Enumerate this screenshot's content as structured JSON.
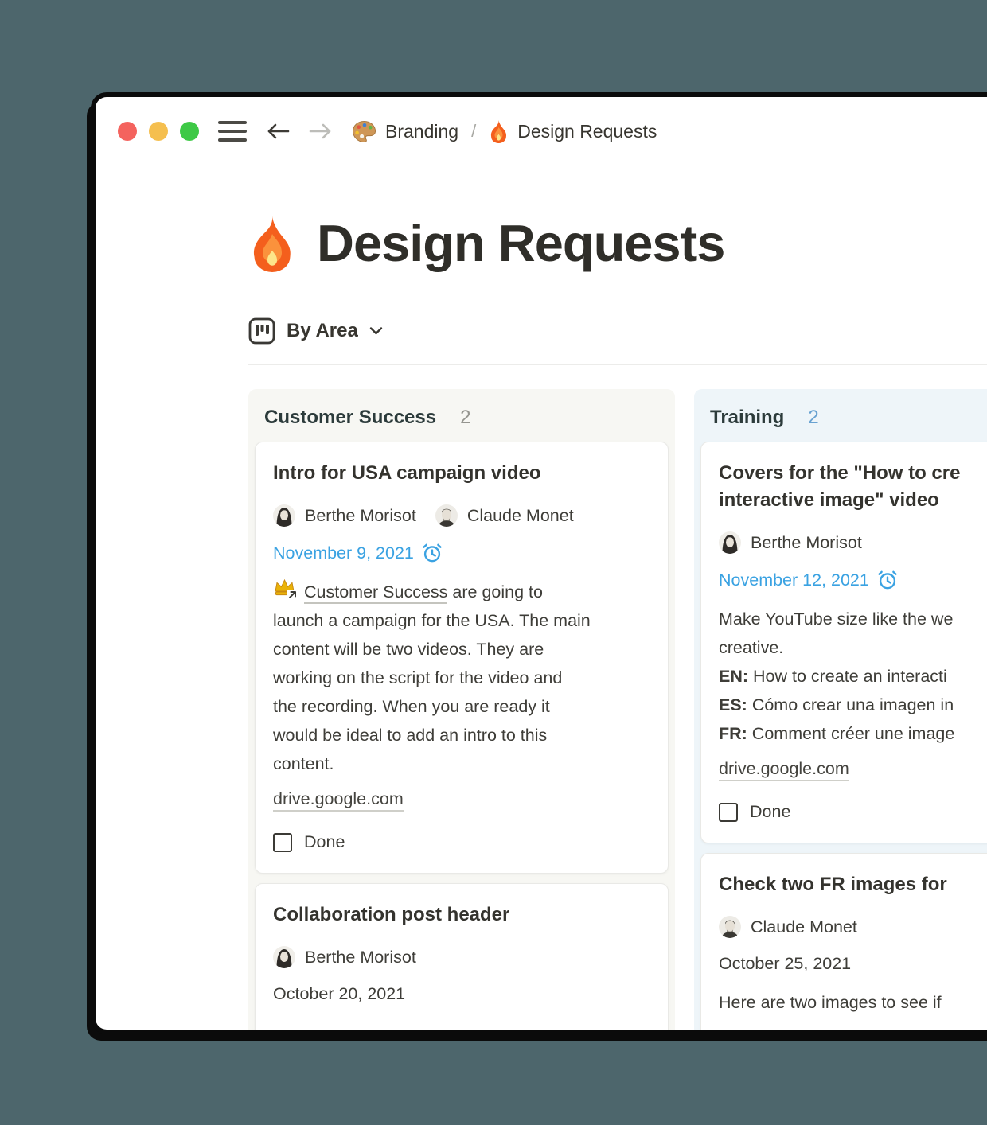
{
  "window_controls": {
    "close": "close",
    "minimize": "minimize",
    "zoom": "zoom",
    "colors": {
      "red": "#f4635e",
      "yellow": "#f5bf4f",
      "green": "#3ec946"
    }
  },
  "topbar": {
    "breadcrumb": {
      "item1": {
        "icon": "palette-icon",
        "label": "Branding"
      },
      "separator": "/",
      "item2": {
        "icon": "fire-icon",
        "label": "Design Requests"
      }
    }
  },
  "page": {
    "icon": "fire-icon",
    "title": "Design Requests",
    "view": {
      "icon": "board-view-icon",
      "label": "By Area"
    }
  },
  "board": {
    "columns": [
      {
        "name": "Customer Success",
        "count": "2",
        "cards": [
          {
            "title": "Intro for USA campaign video",
            "people": [
              "Berthe Morisot",
              "Claude Monet"
            ],
            "date": "November 9, 2021",
            "has_reminder": true,
            "body": {
              "line1_icon": "crown-page-mention-icon",
              "line1_link": "Customer Success",
              "line1_after": " are going to",
              "lines": [
                "launch a campaign for the USA. The main",
                "content will be two videos. They are",
                "working on the script for the video and",
                "the recording. When you are ready it",
                "would be ideal to add an intro to this",
                "content."
              ]
            },
            "weblink": "drive.google.com",
            "checkbox_label": "Done",
            "checkbox_checked": false
          },
          {
            "title": "Collaboration post header",
            "people": [
              "Berthe Morisot"
            ],
            "date": "October 20, 2021",
            "has_reminder": false
          }
        ]
      },
      {
        "name": "Training",
        "count": "2",
        "cards": [
          {
            "title_lines": [
              "Covers for the \"How to cre",
              "interactive image\" video"
            ],
            "people": [
              "Berthe Morisot"
            ],
            "date": "November 12, 2021",
            "has_reminder": true,
            "body_lines": [
              "Make YouTube size like the we",
              "creative."
            ],
            "lang_lines": [
              {
                "b": "EN:",
                "t": " How to create an interacti"
              },
              {
                "b": "ES:",
                "t": " Cómo crear una imagen in"
              },
              {
                "b": "FR:",
                "t": " Comment créer une image"
              }
            ],
            "weblink": "drive.google.com",
            "checkbox_label": "Done",
            "checkbox_checked": false
          },
          {
            "title": "Check two FR images for",
            "people": [
              "Claude Monet"
            ],
            "date": "October 25, 2021",
            "has_reminder": false,
            "body_lines": [
              "Here are two images to see if"
            ]
          }
        ]
      }
    ]
  },
  "colors": {
    "page_background": "#4d666c",
    "window_background": "#ffffff",
    "text_dark": "#37352f",
    "date_reminder_blue": "#3aa2e2",
    "column_customer_success_bg": "#f7f7f3",
    "column_training_bg": "#eef5f9",
    "count_gray": "#95958f",
    "count_blue": "#69a2d1"
  }
}
